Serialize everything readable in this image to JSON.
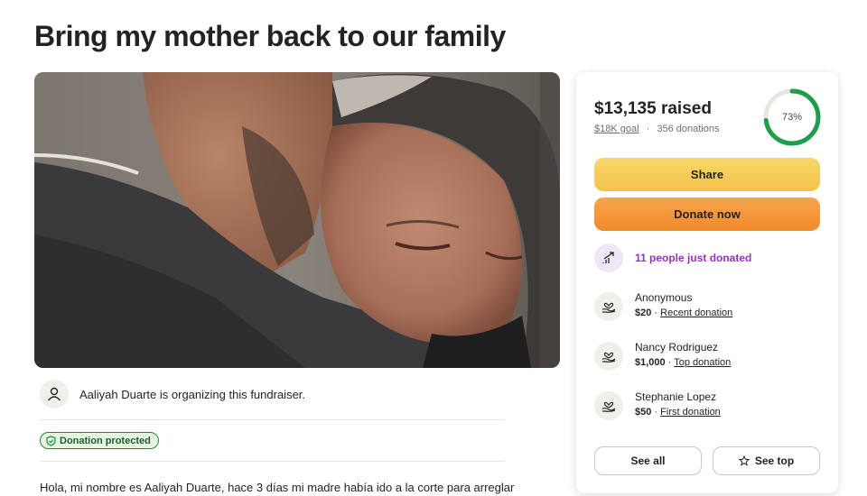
{
  "page": {
    "title": "Bring my mother back to our family"
  },
  "organizer": {
    "text": "Aaliyah Duarte is organizing this fundraiser.",
    "icon": "person-icon"
  },
  "protection": {
    "label": "Donation protected",
    "icon": "shield-icon",
    "color": "#1e8a3a"
  },
  "story": {
    "preview": "Hola, mi nombre es Aaliyah Duarte, hace 3 días mi madre había ido a la corte para arreglar"
  },
  "donation_card": {
    "raised": "$13,135 raised",
    "goal": "$18K goal",
    "separator": "·",
    "donations": "356 donations",
    "progress_label": "73%",
    "progress_value": 0.73,
    "progress_color": "#1e9e4a",
    "share_label": "Share",
    "donate_label": "Donate now",
    "recent_activity": {
      "text": "11 people just donated",
      "icon": "trending-up-icon",
      "color": "#9b2fc9"
    },
    "donors": [
      {
        "name": "Anonymous",
        "amount": "$20",
        "separator": "·",
        "tag": "Recent donation",
        "icon": "heart-hand-icon"
      },
      {
        "name": "Nancy Rodriguez",
        "amount": "$1,000",
        "separator": "·",
        "tag": "Top donation",
        "icon": "heart-hand-icon"
      },
      {
        "name": "Stephanie Lopez",
        "amount": "$50",
        "separator": "·",
        "tag": "First donation",
        "icon": "heart-hand-icon"
      }
    ],
    "see_all_label": "See all",
    "see_top_label": "See top",
    "accent_share": "#f2c24a",
    "accent_donate": "#f08a2c"
  }
}
